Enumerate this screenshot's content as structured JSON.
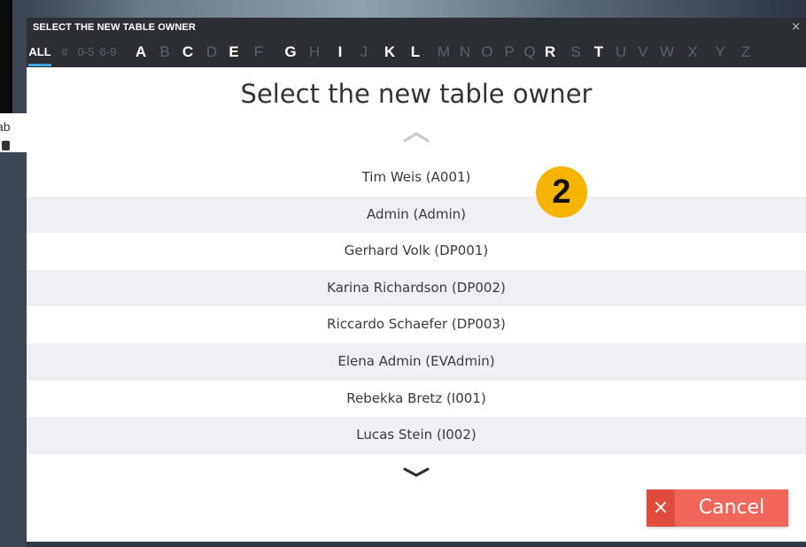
{
  "background": {
    "fragment_text": "ab"
  },
  "dialog": {
    "title": "SELECT THE NEW TABLE OWNER",
    "close_glyph": "×",
    "heading": "Select the new table owner"
  },
  "alphabet": {
    "all": {
      "label": "ALL",
      "active": true
    },
    "letters": [
      {
        "label": "#",
        "enabled": false
      },
      {
        "label": "0-5",
        "enabled": false
      },
      {
        "label": "6-9",
        "enabled": false
      },
      {
        "label": "A",
        "enabled": true
      },
      {
        "label": "B",
        "enabled": false
      },
      {
        "label": "C",
        "enabled": true
      },
      {
        "label": "D",
        "enabled": false
      },
      {
        "label": "E",
        "enabled": true
      },
      {
        "label": "F",
        "enabled": false
      },
      {
        "label": "G",
        "enabled": true
      },
      {
        "label": "H",
        "enabled": false
      },
      {
        "label": "I",
        "enabled": true
      },
      {
        "label": "J",
        "enabled": false
      },
      {
        "label": "K",
        "enabled": true
      },
      {
        "label": "L",
        "enabled": true
      },
      {
        "label": "M",
        "enabled": false
      },
      {
        "label": "N",
        "enabled": false
      },
      {
        "label": "O",
        "enabled": false
      },
      {
        "label": "P",
        "enabled": false
      },
      {
        "label": "Q",
        "enabled": false
      },
      {
        "label": "R",
        "enabled": true
      },
      {
        "label": "S",
        "enabled": false
      },
      {
        "label": "T",
        "enabled": true
      },
      {
        "label": "U",
        "enabled": false
      },
      {
        "label": "V",
        "enabled": false
      },
      {
        "label": "W",
        "enabled": false
      },
      {
        "label": "X",
        "enabled": false
      },
      {
        "label": "Y",
        "enabled": false
      },
      {
        "label": "Z",
        "enabled": false
      }
    ]
  },
  "owners": [
    "Tim Weis (A001)",
    "Admin (Admin)",
    "Gerhard Volk (DP001)",
    "Karina Richardson (DP002)",
    "Riccardo Schaefer (DP003)",
    "Elena Admin (EVAdmin)",
    "Rebekka Bretz (I001)",
    "Lucas Stein (I002)"
  ],
  "step_badge": "2",
  "cancel": {
    "icon": "close-icon",
    "glyph": "×",
    "label": "Cancel"
  },
  "icons": {
    "scroll_up": "chevron-up-icon",
    "scroll_down": "chevron-down-icon"
  },
  "colors": {
    "accent": "#3fa7e0",
    "cancel": "#f0665a",
    "cancel_icon_bg": "#e04b3f",
    "badge": "#f4b400",
    "titlebar": "#2b2f33"
  }
}
